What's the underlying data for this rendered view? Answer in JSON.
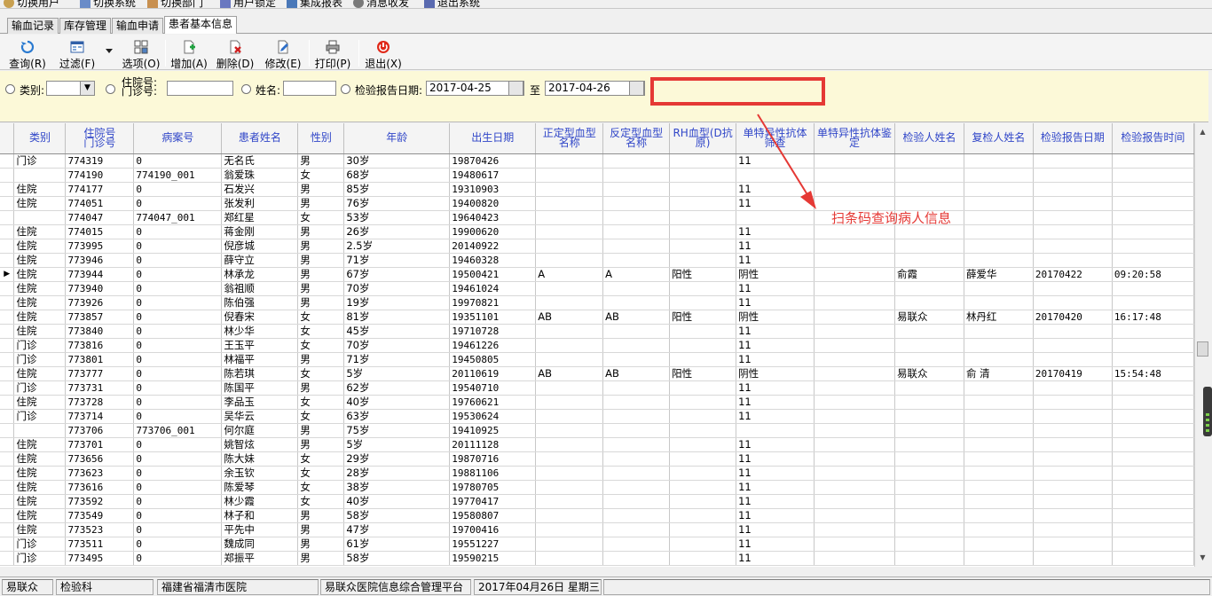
{
  "menubar": {
    "items": [
      "切换用户",
      "切换系统",
      "切换部门",
      "用户锁定",
      "集成报表",
      "消息收发",
      "退出系统"
    ]
  },
  "tabs": [
    "输血记录",
    "库存管理",
    "输血申请",
    "患者基本信息"
  ],
  "toolbar": [
    {
      "label": "查询",
      "key": "R",
      "icon": "query-icon"
    },
    {
      "label": "过滤",
      "key": "F",
      "icon": "filter-icon"
    },
    {
      "label": "选项",
      "key": "O",
      "icon": "options-icon"
    },
    {
      "label": "增加",
      "key": "A",
      "icon": "add-icon"
    },
    {
      "label": "删除",
      "key": "D",
      "icon": "delete-icon"
    },
    {
      "label": "修改",
      "key": "E",
      "icon": "edit-icon"
    },
    {
      "label": "打印",
      "key": "P",
      "icon": "print-icon"
    },
    {
      "label": "退出",
      "key": "X",
      "icon": "exit-icon"
    }
  ],
  "filter": {
    "category_label": "类别:",
    "inpatient_label": "住院号:",
    "outpatient_label": "门诊号:",
    "name_label": "姓名:",
    "date_label": "检验报告日期:",
    "date_from": "2017-04-25",
    "date_to_label": "至",
    "date_to": "2017-04-26"
  },
  "annotation": "扫条码查询病人信息",
  "colors": {
    "annotation": "#e53935",
    "header_text": "#3046c8",
    "filter_bg": "#fcf9d8"
  },
  "table": {
    "headers": [
      {
        "l1": "类别",
        "l2": ""
      },
      {
        "l1": "住院号",
        "l2": "门诊号"
      },
      {
        "l1": "病案号",
        "l2": ""
      },
      {
        "l1": "患者姓名",
        "l2": ""
      },
      {
        "l1": "性别",
        "l2": ""
      },
      {
        "l1": "年龄",
        "l2": ""
      },
      {
        "l1": "出生日期",
        "l2": ""
      },
      {
        "l1": "正定型血型",
        "l2": "名称"
      },
      {
        "l1": "反定型血型",
        "l2": "名称"
      },
      {
        "l1": "RH血型(D抗",
        "l2": "原)"
      },
      {
        "l1": "单特异性抗体",
        "l2": "筛查"
      },
      {
        "l1": "单特异性抗体鉴",
        "l2": "定"
      },
      {
        "l1": "检验人姓名",
        "l2": ""
      },
      {
        "l1": "复检人姓名",
        "l2": ""
      },
      {
        "l1": "检验报告日期",
        "l2": ""
      },
      {
        "l1": "检验报告时间",
        "l2": ""
      }
    ],
    "current_row": 8,
    "rows": [
      [
        "门诊",
        "774319",
        "0",
        "无名氏",
        "男",
        "30岁",
        "19870426",
        "",
        "",
        "",
        "11",
        "",
        "",
        "",
        "",
        ""
      ],
      [
        "",
        "774190",
        "774190_001",
        "翁爱珠",
        "女",
        "68岁",
        "19480617",
        "",
        "",
        "",
        "",
        "",
        "",
        "",
        "",
        ""
      ],
      [
        "住院",
        "774177",
        "0",
        "石发兴",
        "男",
        "85岁",
        "19310903",
        "",
        "",
        "",
        "11",
        "",
        "",
        "",
        "",
        ""
      ],
      [
        "住院",
        "774051",
        "0",
        "张发利",
        "男",
        "76岁",
        "19400820",
        "",
        "",
        "",
        "11",
        "",
        "",
        "",
        "",
        ""
      ],
      [
        "",
        "774047",
        "774047_001",
        "郑红星",
        "女",
        "53岁",
        "19640423",
        "",
        "",
        "",
        "",
        "",
        "",
        "",
        "",
        ""
      ],
      [
        "住院",
        "774015",
        "0",
        "蒋金刚",
        "男",
        "26岁",
        "19900620",
        "",
        "",
        "",
        "11",
        "",
        "",
        "",
        "",
        ""
      ],
      [
        "住院",
        "773995",
        "0",
        "倪彦城",
        "男",
        "2.5岁",
        "20140922",
        "",
        "",
        "",
        "11",
        "",
        "",
        "",
        "",
        ""
      ],
      [
        "住院",
        "773946",
        "0",
        "薛守立",
        "男",
        "71岁",
        "19460328",
        "",
        "",
        "",
        "11",
        "",
        "",
        "",
        "",
        ""
      ],
      [
        "住院",
        "773944",
        "0",
        "林承龙",
        "男",
        "67岁",
        "19500421",
        "A",
        "A",
        "阳性",
        "阴性",
        "",
        "俞霞",
        "薛爱华",
        "20170422",
        "09:20:58"
      ],
      [
        "住院",
        "773940",
        "0",
        "翁祖顺",
        "男",
        "70岁",
        "19461024",
        "",
        "",
        "",
        "11",
        "",
        "",
        "",
        "",
        ""
      ],
      [
        "住院",
        "773926",
        "0",
        "陈伯强",
        "男",
        "19岁",
        "19970821",
        "",
        "",
        "",
        "11",
        "",
        "",
        "",
        "",
        ""
      ],
      [
        "住院",
        "773857",
        "0",
        "倪春宋",
        "女",
        "81岁",
        "19351101",
        "AB",
        "AB",
        "阳性",
        "阴性",
        "",
        "易联众",
        "林丹红",
        "20170420",
        "16:17:48"
      ],
      [
        "住院",
        "773840",
        "0",
        "林少华",
        "女",
        "45岁",
        "19710728",
        "",
        "",
        "",
        "11",
        "",
        "",
        "",
        "",
        ""
      ],
      [
        "门诊",
        "773816",
        "0",
        "王玉平",
        "女",
        "70岁",
        "19461226",
        "",
        "",
        "",
        "11",
        "",
        "",
        "",
        "",
        ""
      ],
      [
        "门诊",
        "773801",
        "0",
        "林福平",
        "男",
        "71岁",
        "19450805",
        "",
        "",
        "",
        "11",
        "",
        "",
        "",
        "",
        ""
      ],
      [
        "住院",
        "773777",
        "0",
        "陈若琪",
        "女",
        "5岁",
        "20110619",
        "AB",
        "AB",
        "阳性",
        "阴性",
        "",
        "易联众",
        "俞  清",
        "20170419",
        "15:54:48"
      ],
      [
        "门诊",
        "773731",
        "0",
        "陈国平",
        "男",
        "62岁",
        "19540710",
        "",
        "",
        "",
        "11",
        "",
        "",
        "",
        "",
        ""
      ],
      [
        "住院",
        "773728",
        "0",
        "李品玉",
        "女",
        "40岁",
        "19760621",
        "",
        "",
        "",
        "11",
        "",
        "",
        "",
        "",
        ""
      ],
      [
        "门诊",
        "773714",
        "0",
        "吴华云",
        "女",
        "63岁",
        "19530624",
        "",
        "",
        "",
        "11",
        "",
        "",
        "",
        "",
        ""
      ],
      [
        "",
        "773706",
        "773706_001",
        "何尔庭",
        "男",
        "75岁",
        "19410925",
        "",
        "",
        "",
        "",
        "",
        "",
        "",
        "",
        ""
      ],
      [
        "住院",
        "773701",
        "0",
        "姚智炫",
        "男",
        "5岁",
        "20111128",
        "",
        "",
        "",
        "11",
        "",
        "",
        "",
        "",
        ""
      ],
      [
        "住院",
        "773656",
        "0",
        "陈大妹",
        "女",
        "29岁",
        "19870716",
        "",
        "",
        "",
        "11",
        "",
        "",
        "",
        "",
        ""
      ],
      [
        "住院",
        "773623",
        "0",
        "余玉钦",
        "女",
        "28岁",
        "19881106",
        "",
        "",
        "",
        "11",
        "",
        "",
        "",
        "",
        ""
      ],
      [
        "住院",
        "773616",
        "0",
        "陈爱琴",
        "女",
        "38岁",
        "19780705",
        "",
        "",
        "",
        "11",
        "",
        "",
        "",
        "",
        ""
      ],
      [
        "住院",
        "773592",
        "0",
        "林少霞",
        "女",
        "40岁",
        "19770417",
        "",
        "",
        "",
        "11",
        "",
        "",
        "",
        "",
        ""
      ],
      [
        "住院",
        "773549",
        "0",
        "林子和",
        "男",
        "58岁",
        "19580807",
        "",
        "",
        "",
        "11",
        "",
        "",
        "",
        "",
        ""
      ],
      [
        "住院",
        "773523",
        "0",
        "平先中",
        "男",
        "47岁",
        "19700416",
        "",
        "",
        "",
        "11",
        "",
        "",
        "",
        "",
        ""
      ],
      [
        "门诊",
        "773511",
        "0",
        "魏成同",
        "男",
        "61岁",
        "19551227",
        "",
        "",
        "",
        "11",
        "",
        "",
        "",
        "",
        ""
      ],
      [
        "门诊",
        "773495",
        "0",
        "郑振平",
        "男",
        "58岁",
        "19590215",
        "",
        "",
        "",
        "11",
        "",
        "",
        "",
        "",
        ""
      ]
    ]
  },
  "statusbar": [
    "易联众",
    "检验科",
    "福建省福清市医院",
    "易联众医院信息综合管理平台",
    "2017年04月26日 星期三"
  ]
}
